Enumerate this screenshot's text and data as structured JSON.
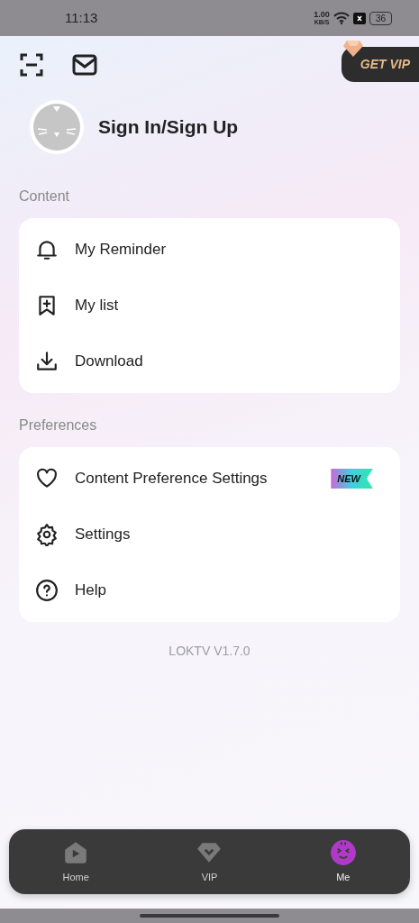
{
  "status_bar": {
    "time": "11:13",
    "speed": "1.00",
    "speed_unit": "KB/S",
    "battery": "36"
  },
  "vip_button": "GET VIP",
  "profile": {
    "label": "Sign In/Sign Up"
  },
  "sections": [
    {
      "title": "Content",
      "items": [
        {
          "label": "My Reminder"
        },
        {
          "label": "My list"
        },
        {
          "label": "Download"
        }
      ]
    },
    {
      "title": "Preferences",
      "items": [
        {
          "label": "Content Preference Settings",
          "badge": "NEW"
        },
        {
          "label": "Settings"
        },
        {
          "label": "Help"
        }
      ]
    }
  ],
  "version": "LOKTV V1.7.0",
  "tabs": [
    {
      "label": "Home",
      "selected": false
    },
    {
      "label": "VIP",
      "selected": false
    },
    {
      "label": "Me",
      "selected": true
    }
  ]
}
